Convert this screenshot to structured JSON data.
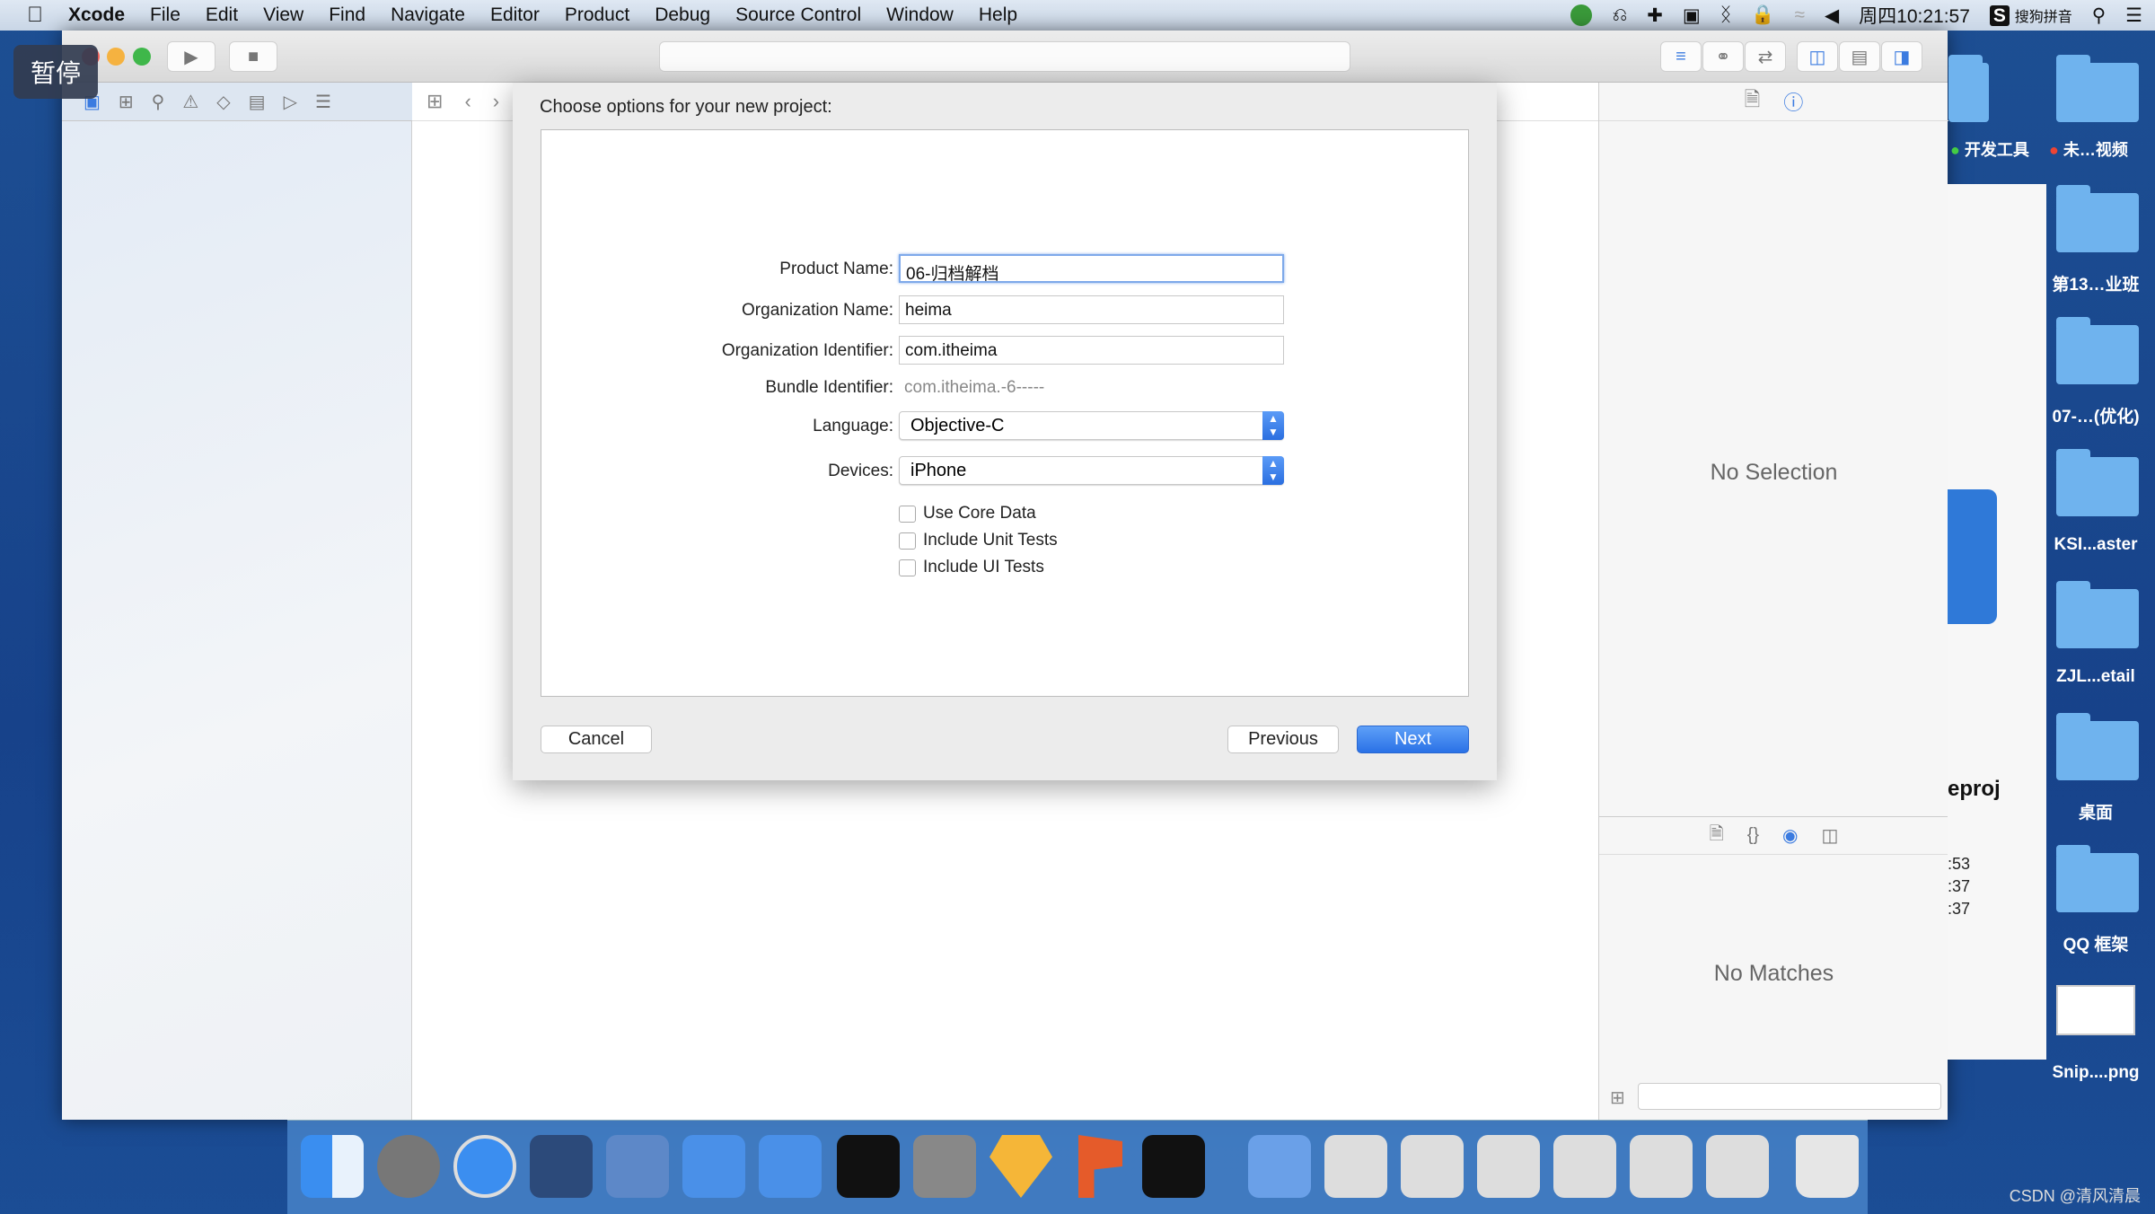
{
  "menubar": {
    "app": "Xcode",
    "items": [
      "File",
      "Edit",
      "View",
      "Find",
      "Navigate",
      "Editor",
      "Product",
      "Debug",
      "Source Control",
      "Window",
      "Help"
    ],
    "clock": "周四10:21:57",
    "ime": "搜狗拼音"
  },
  "overlay": {
    "pause": "暂停"
  },
  "dialog": {
    "title": "Choose options for your new project:",
    "fields": {
      "product_name_label": "Product Name:",
      "product_name": "06-归档解档",
      "org_name_label": "Organization Name:",
      "org_name": "heima",
      "org_id_label": "Organization Identifier:",
      "org_id": "com.itheima",
      "bundle_label": "Bundle Identifier:",
      "bundle": "com.itheima.-6-----",
      "language_label": "Language:",
      "language": "Objective-C",
      "devices_label": "Devices:",
      "devices": "iPhone"
    },
    "checkboxes": [
      {
        "label": "Use Core Data",
        "checked": false
      },
      {
        "label": "Include Unit Tests",
        "checked": false
      },
      {
        "label": "Include UI Tests",
        "checked": false
      }
    ],
    "cancel": "Cancel",
    "previous": "Previous",
    "next": "Next"
  },
  "inspector": {
    "no_selection": "No Selection",
    "no_matches": "No Matches"
  },
  "desktop": {
    "tags": [
      "开发工具",
      "未…视频"
    ],
    "icons": [
      "第13…业班",
      "07-…(优化)",
      "KSI...aster",
      "ZJL...etail",
      "桌面",
      "QQ 框架",
      "Snip....png"
    ],
    "behind_window": {
      "name": "eproj",
      "times": [
        ":53",
        ":37",
        ":37"
      ]
    }
  },
  "watermark": "CSDN @清风清晨",
  "colors": {
    "accent": "#2a71e6",
    "desktop": "#1d4f93"
  }
}
